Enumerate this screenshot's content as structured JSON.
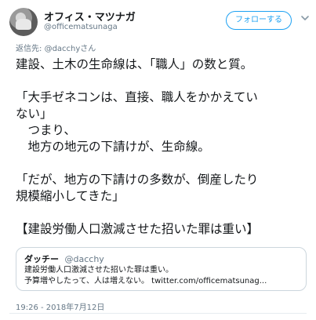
{
  "author": {
    "display_name": "オフィス・マツナガ",
    "handle": "@officematsunaga"
  },
  "follow_button": {
    "label": "フォローする"
  },
  "reply_to": {
    "prefix": "返信先:",
    "handle": "@dacchyさん"
  },
  "tweet": {
    "lines": [
      "建設、土木の生命線は、「職人」の数と質。",
      "",
      "「大手ゼネコンは、直接、職人をかかえてい",
      "ない」",
      "　つまり、",
      "　地方の地元の下請けが、生命線。",
      "",
      "「だが、地方の下請けの多数が、倒産したり",
      "規模縮小してきた」",
      "",
      "【建設労働人口激減させた招いた罪は重い】"
    ]
  },
  "quoted_tweet": {
    "name": "ダッチー",
    "handle": "@dacchy",
    "line1": "建設労働人口激減させた招いた罪は重い。",
    "line2": "予算増やしたって、人は増えない。 twitter.com/officematsunag..."
  },
  "timestamp": "19:26 - 2018年7月12日",
  "colors": {
    "accent": "#1da1f2",
    "text": "#14171a",
    "muted": "#657786",
    "border": "#ccd6dd"
  },
  "icons": {
    "avatar": "avatar-image",
    "menu": "chevron-down-icon"
  }
}
